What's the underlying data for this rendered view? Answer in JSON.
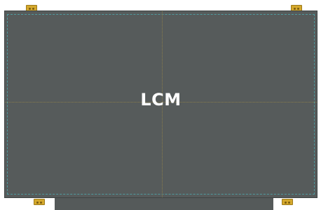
{
  "diagram": {
    "label": "LCM",
    "colors": {
      "panel": "#565b5b",
      "active_area_outline": "#4f9a9e",
      "center_lines": "#8a7d4c",
      "mounting_tab": "#d4a82c",
      "label_text": "#ffffff"
    },
    "mounting_tabs": [
      {
        "name": "top-left"
      },
      {
        "name": "top-right"
      },
      {
        "name": "bottom-left"
      },
      {
        "name": "bottom-right"
      }
    ]
  }
}
